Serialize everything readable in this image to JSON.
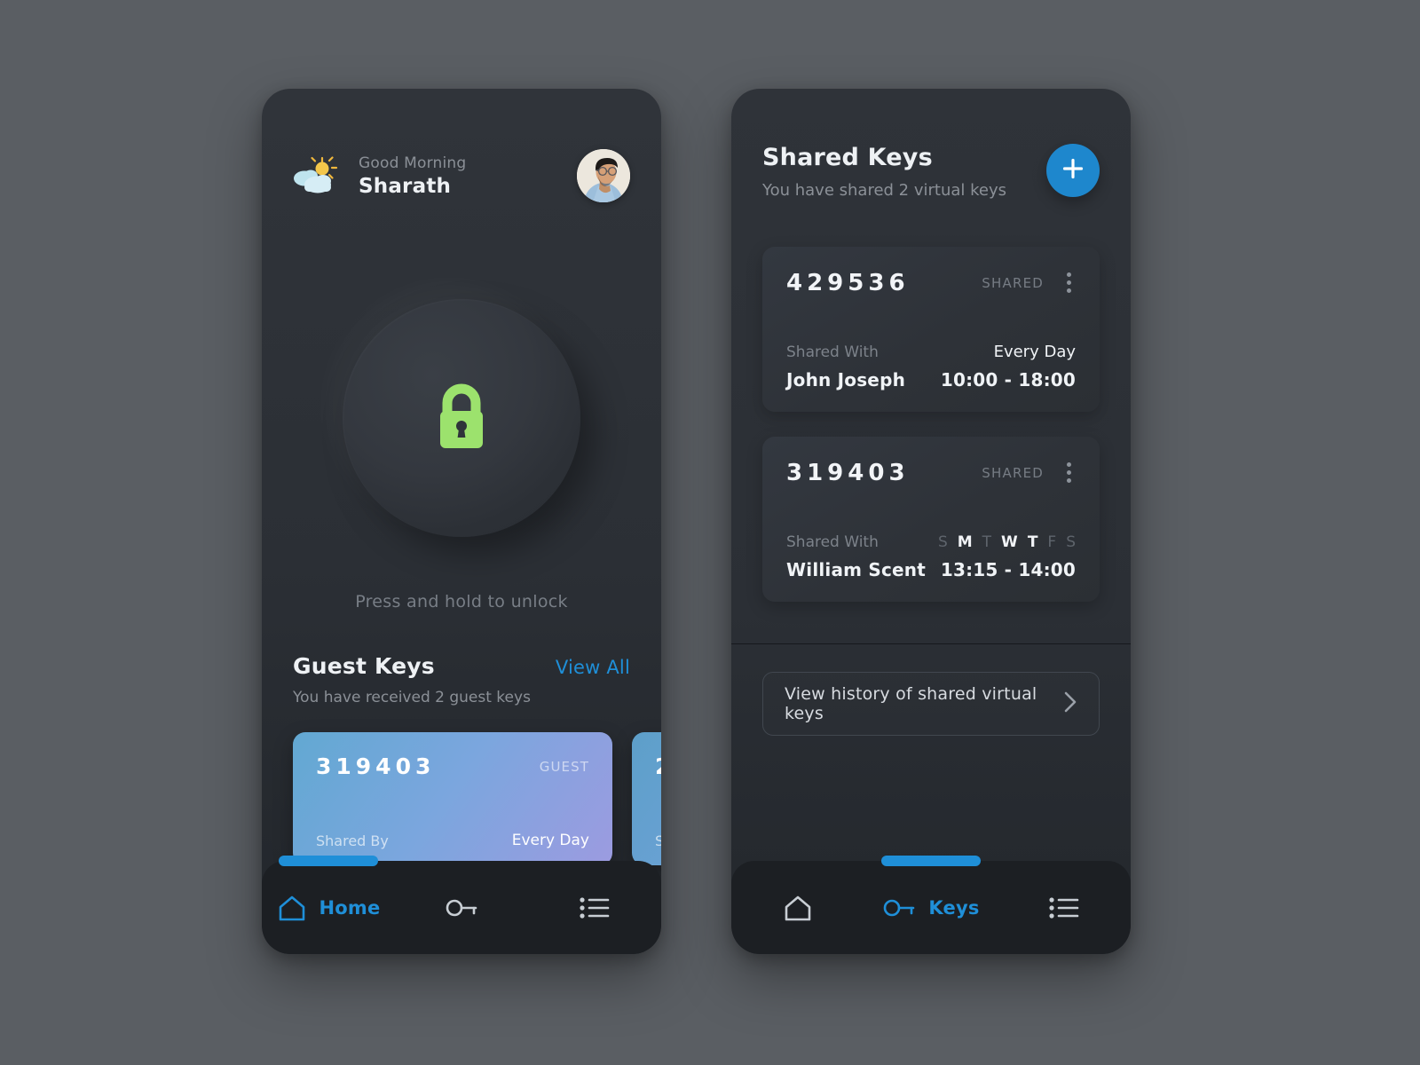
{
  "theme": {
    "page_bg": "#5a5e63",
    "phone_bg": "#2e3238",
    "accent_blue": "#1f8fd8",
    "lock_green": "#9ce26d",
    "muted_text": "#8b9097"
  },
  "left_phone": {
    "header": {
      "weather_icon": "sun-behind-cloud-icon",
      "greeting": "Good Morning",
      "user_name": "Sharath",
      "avatar": "user-avatar-photo"
    },
    "unlock": {
      "icon": "padlock-closed-icon",
      "hint": "Press and hold to unlock"
    },
    "guest_section": {
      "title": "Guest Keys",
      "view_all": "View All",
      "subtitle": "You have received 2 guest keys",
      "cards": [
        {
          "code": "319403",
          "tag": "GUEST",
          "shared_by_label": "Shared By",
          "frequency": "Every Day"
        },
        {
          "code": "2",
          "tag": "",
          "shared_by_label": "S",
          "frequency": ""
        }
      ]
    },
    "nav": {
      "items": [
        {
          "icon": "home-icon",
          "label": "Home",
          "active": true
        },
        {
          "icon": "key-icon",
          "label": "",
          "active": false
        },
        {
          "icon": "list-icon",
          "label": "",
          "active": false
        }
      ]
    }
  },
  "right_phone": {
    "header": {
      "title": "Shared Keys",
      "subtitle": "You have shared 2 virtual keys",
      "add_button": "plus-icon"
    },
    "cards": [
      {
        "code": "429536",
        "tag": "SHARED",
        "menu": "kebab-menu-icon",
        "shared_with_label": "Shared With",
        "person": "John Joseph",
        "frequency": "Every Day",
        "days": null,
        "time": "10:00 - 18:00"
      },
      {
        "code": "319403",
        "tag": "SHARED",
        "menu": "kebab-menu-icon",
        "shared_with_label": "Shared With",
        "person": "William Scent",
        "frequency": "",
        "days": [
          {
            "label": "S",
            "active": false
          },
          {
            "label": "M",
            "active": true
          },
          {
            "label": "T",
            "active": false
          },
          {
            "label": "W",
            "active": true
          },
          {
            "label": "T",
            "active": true
          },
          {
            "label": "F",
            "active": false
          },
          {
            "label": "S",
            "active": false
          }
        ],
        "time": "13:15 - 14:00"
      }
    ],
    "history": {
      "label": "View history of shared virtual keys",
      "chevron": "chevron-right-icon"
    },
    "nav": {
      "items": [
        {
          "icon": "home-icon",
          "label": "",
          "active": false
        },
        {
          "icon": "key-icon",
          "label": "Keys",
          "active": true
        },
        {
          "icon": "list-icon",
          "label": "",
          "active": false
        }
      ]
    }
  }
}
